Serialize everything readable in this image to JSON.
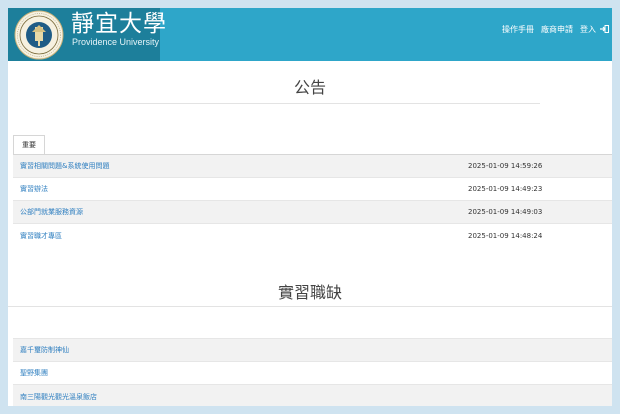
{
  "header": {
    "university_name": "靜宜大學",
    "university_name_en": "Providence University",
    "seal_text": "PROVIDENCE UNIVERSITY",
    "nav": {
      "manual": "操作手冊",
      "vendor_apply": "廠商申請",
      "login": "登入"
    },
    "colors": {
      "bar": "#2ea6c9",
      "logo_box": "#1d7f9b"
    }
  },
  "announcements": {
    "title": "公告",
    "tab_label": "重要",
    "items": [
      {
        "title": "實習相關問題&系統使用問題",
        "date": "2025-01-09 14:59:26"
      },
      {
        "title": "實習辦法",
        "date": "2025-01-09 14:49:23"
      },
      {
        "title": "公部門就業服務資源",
        "date": "2025-01-09 14:49:03"
      },
      {
        "title": "實習職才專區",
        "date": "2025-01-09 14:48:24"
      }
    ]
  },
  "openings": {
    "title": "實習職缺",
    "items": [
      {
        "title": "嘉千璽防制神仙"
      },
      {
        "title": "聖野集團"
      },
      {
        "title": "南三陽觀光觀光溫泉飯店"
      }
    ]
  },
  "colors": {
    "link": "#2f7fc0",
    "row_stripe": "#f2f2f2"
  }
}
